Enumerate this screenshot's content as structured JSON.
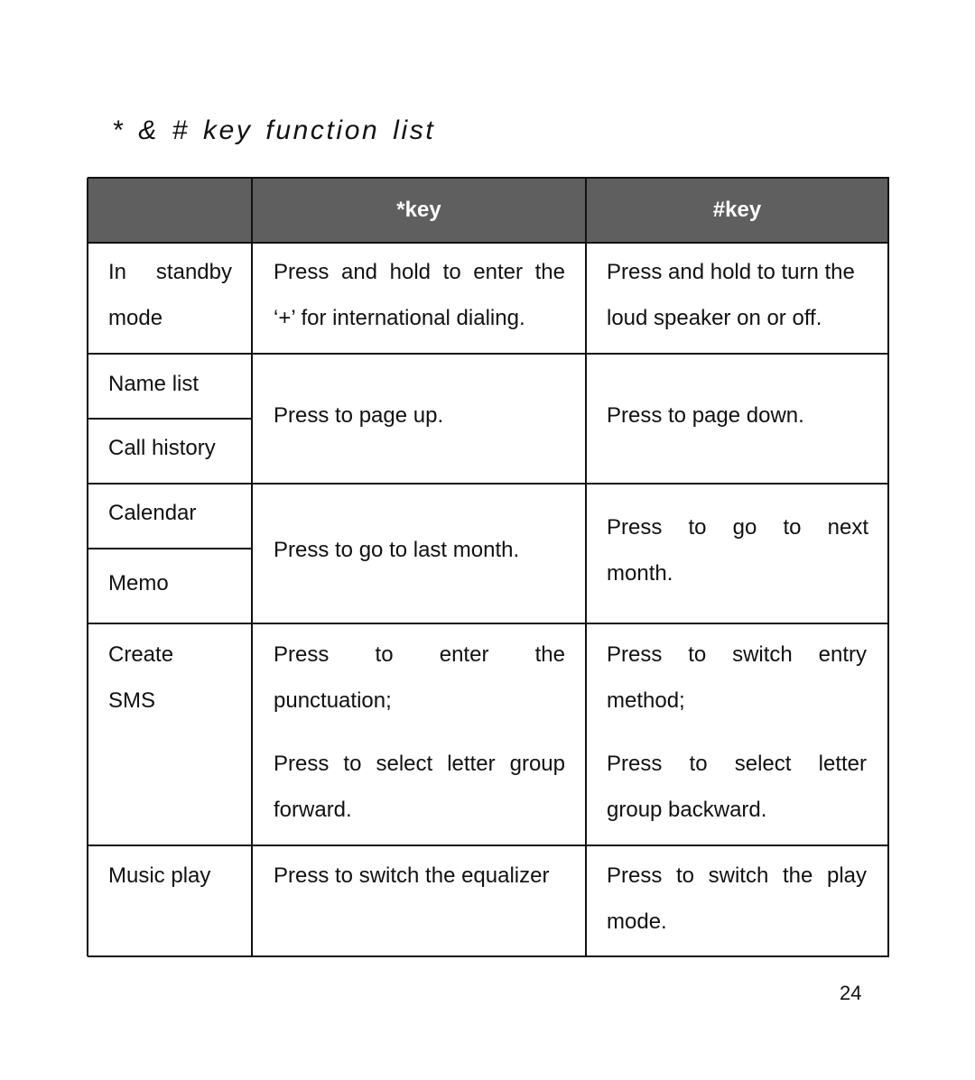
{
  "document": {
    "title": "* & # key function list",
    "page_number": "24"
  },
  "table": {
    "header": [
      "",
      "*key",
      "#key"
    ],
    "rows": [
      {
        "modes": [
          "In standby mode"
        ],
        "star_key": [
          "Press and hold to enter the ‘+’ for international dialing."
        ],
        "hash_key": [
          "Press and hold to turn the loud speaker on or off."
        ]
      },
      {
        "modes": [
          "Name list",
          "Call history"
        ],
        "star_key": [
          "Press to page up."
        ],
        "hash_key": [
          "Press to page down."
        ]
      },
      {
        "modes": [
          "Calendar",
          "Memo"
        ],
        "star_key": [
          "Press to go to last month."
        ],
        "hash_key": [
          "Press to go to next month."
        ]
      },
      {
        "modes": [
          "Create SMS"
        ],
        "star_key": [
          "Press to enter the punctuation;",
          "Press to select letter group forward."
        ],
        "hash_key": [
          "Press to switch entry method;",
          "Press to select letter group backward."
        ]
      },
      {
        "modes": [
          "Music play"
        ],
        "star_key": [
          "Press to switch the equalizer"
        ],
        "hash_key": [
          "Press to switch the play mode."
        ]
      }
    ]
  },
  "lines": {
    "standby_col1": [
      "In standby",
      "mode"
    ],
    "standby_col2": [
      "Press and hold to enter the",
      "‘+’ for international dialing."
    ],
    "standby_col3": [
      "Press and hold to turn the",
      "loud speaker on or off."
    ],
    "next_month": [
      "Press to go to next",
      "month."
    ],
    "sms_col1": [
      "Create",
      "SMS"
    ],
    "sms_col2a": [
      "Press to enter the",
      "punctuation;"
    ],
    "sms_col2b": [
      "Press to select letter group",
      "forward."
    ],
    "sms_col3a": [
      "Press to switch entry",
      "method;"
    ],
    "sms_col3b": [
      "Press to select letter",
      "group backward."
    ],
    "music_col3": [
      "Press to switch the play",
      "mode."
    ]
  }
}
